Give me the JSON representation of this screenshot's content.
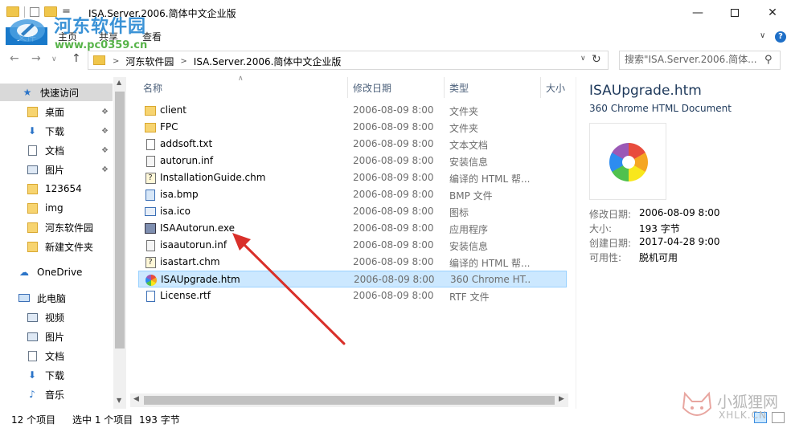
{
  "window": {
    "title": "ISA.Server.2006.简体中文企业版",
    "minimize": "—",
    "close": "✕"
  },
  "watermark": {
    "site_name": "河东软件园",
    "site_url": "www.pc0359.cn",
    "corner_text": "小狐狸网",
    "corner_sub": "XHLK.CN"
  },
  "ribbon": {
    "file": "文件",
    "tabs": [
      "主页",
      "共享",
      "查看"
    ],
    "help": "?"
  },
  "address": {
    "crumbs": [
      "河东软件园",
      "ISA.Server.2006.简体中文企业版"
    ],
    "search_placeholder": "搜索\"ISA.Server.2006.简体...",
    "nav_back": "←",
    "nav_forward": "→",
    "nav_up": "↑"
  },
  "navpane": {
    "quick_access": "快速访问",
    "items": [
      {
        "label": "桌面",
        "icon": "folder-icon",
        "pinned": true
      },
      {
        "label": "下载",
        "icon": "download-icon",
        "pinned": true
      },
      {
        "label": "文档",
        "icon": "document-icon",
        "pinned": true
      },
      {
        "label": "图片",
        "icon": "picture-icon",
        "pinned": true
      },
      {
        "label": "123654",
        "icon": "folder-icon",
        "pinned": false
      },
      {
        "label": "img",
        "icon": "folder-icon",
        "pinned": false
      },
      {
        "label": "河东软件园",
        "icon": "folder-icon",
        "pinned": false
      },
      {
        "label": "新建文件夹",
        "icon": "folder-icon",
        "pinned": false
      }
    ],
    "onedrive": "OneDrive",
    "this_pc": "此电脑",
    "pc_items": [
      {
        "label": "视频",
        "icon": "video-icon"
      },
      {
        "label": "图片",
        "icon": "picture-icon"
      },
      {
        "label": "文档",
        "icon": "document-icon"
      },
      {
        "label": "下载",
        "icon": "download-icon"
      },
      {
        "label": "音乐",
        "icon": "music-icon"
      }
    ]
  },
  "filelist": {
    "columns": {
      "name": "名称",
      "date": "修改日期",
      "type": "类型",
      "size": "大小"
    },
    "files": [
      {
        "name": "client",
        "date": "2006-08-09 8:00",
        "type": "文件夹",
        "icon": "folder-icon"
      },
      {
        "name": "FPC",
        "date": "2006-08-09 8:00",
        "type": "文件夹",
        "icon": "folder-icon"
      },
      {
        "name": "addsoft.txt",
        "date": "2006-08-09 8:00",
        "type": "文本文档",
        "icon": "text-file-icon"
      },
      {
        "name": "autorun.inf",
        "date": "2006-08-09 8:00",
        "type": "安装信息",
        "icon": "inf-file-icon"
      },
      {
        "name": "InstallationGuide.chm",
        "date": "2006-08-09 8:00",
        "type": "编译的 HTML 帮...",
        "icon": "chm-file-icon"
      },
      {
        "name": "isa.bmp",
        "date": "2006-08-09 8:00",
        "type": "BMP 文件",
        "icon": "bmp-file-icon"
      },
      {
        "name": "isa.ico",
        "date": "2006-08-09 8:00",
        "type": "图标",
        "icon": "ico-file-icon"
      },
      {
        "name": "ISAAutorun.exe",
        "date": "2006-08-09 8:00",
        "type": "应用程序",
        "icon": "exe-file-icon"
      },
      {
        "name": "isaautorun.inf",
        "date": "2006-08-09 8:00",
        "type": "安装信息",
        "icon": "inf-file-icon"
      },
      {
        "name": "isastart.chm",
        "date": "2006-08-09 8:00",
        "type": "编译的 HTML 帮...",
        "icon": "chm-file-icon"
      },
      {
        "name": "ISAUpgrade.htm",
        "date": "2006-08-09 8:00",
        "type": "360 Chrome HT...",
        "icon": "chrome360-file-icon",
        "selected": true
      },
      {
        "name": "License.rtf",
        "date": "2006-08-09 8:00",
        "type": "RTF 文件",
        "icon": "rtf-file-icon"
      }
    ]
  },
  "details": {
    "name": "ISAUpgrade.htm",
    "type": "360 Chrome HTML Document",
    "props": [
      {
        "k": "修改日期:",
        "v": "2006-08-09 8:00"
      },
      {
        "k": "大小:",
        "v": "193 字节"
      },
      {
        "k": "创建日期:",
        "v": "2017-04-28 9:00"
      },
      {
        "k": "可用性:",
        "v": "脱机可用"
      }
    ]
  },
  "status": {
    "count": "12 个项目",
    "selected": "选中 1 个项目",
    "size": "193 字节"
  },
  "colors": {
    "accent": "#1979ca",
    "selection": "#cce8ff",
    "arrow": "#d9302a"
  }
}
